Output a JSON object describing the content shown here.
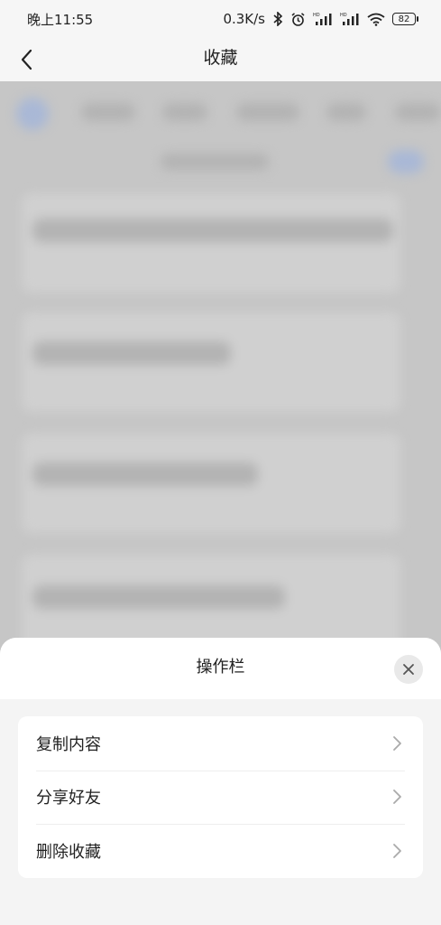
{
  "status_bar": {
    "time": "晚上11:55",
    "net_speed": "0.3K/s",
    "battery": "82"
  },
  "nav": {
    "title": "收藏",
    "icons": {
      "back": "chevron-left-icon"
    }
  },
  "sheet": {
    "title": "操作栏",
    "items": [
      {
        "label": "复制内容"
      },
      {
        "label": "分享好友"
      },
      {
        "label": "删除收藏"
      }
    ],
    "icons": {
      "close": "close-icon",
      "item_arrow": "chevron-right-icon"
    }
  },
  "colors": {
    "overlay_bg": "#c9c9c9",
    "sheet_bg": "#f4f4f4",
    "card_bg": "#ffffff",
    "text": "#222222"
  }
}
